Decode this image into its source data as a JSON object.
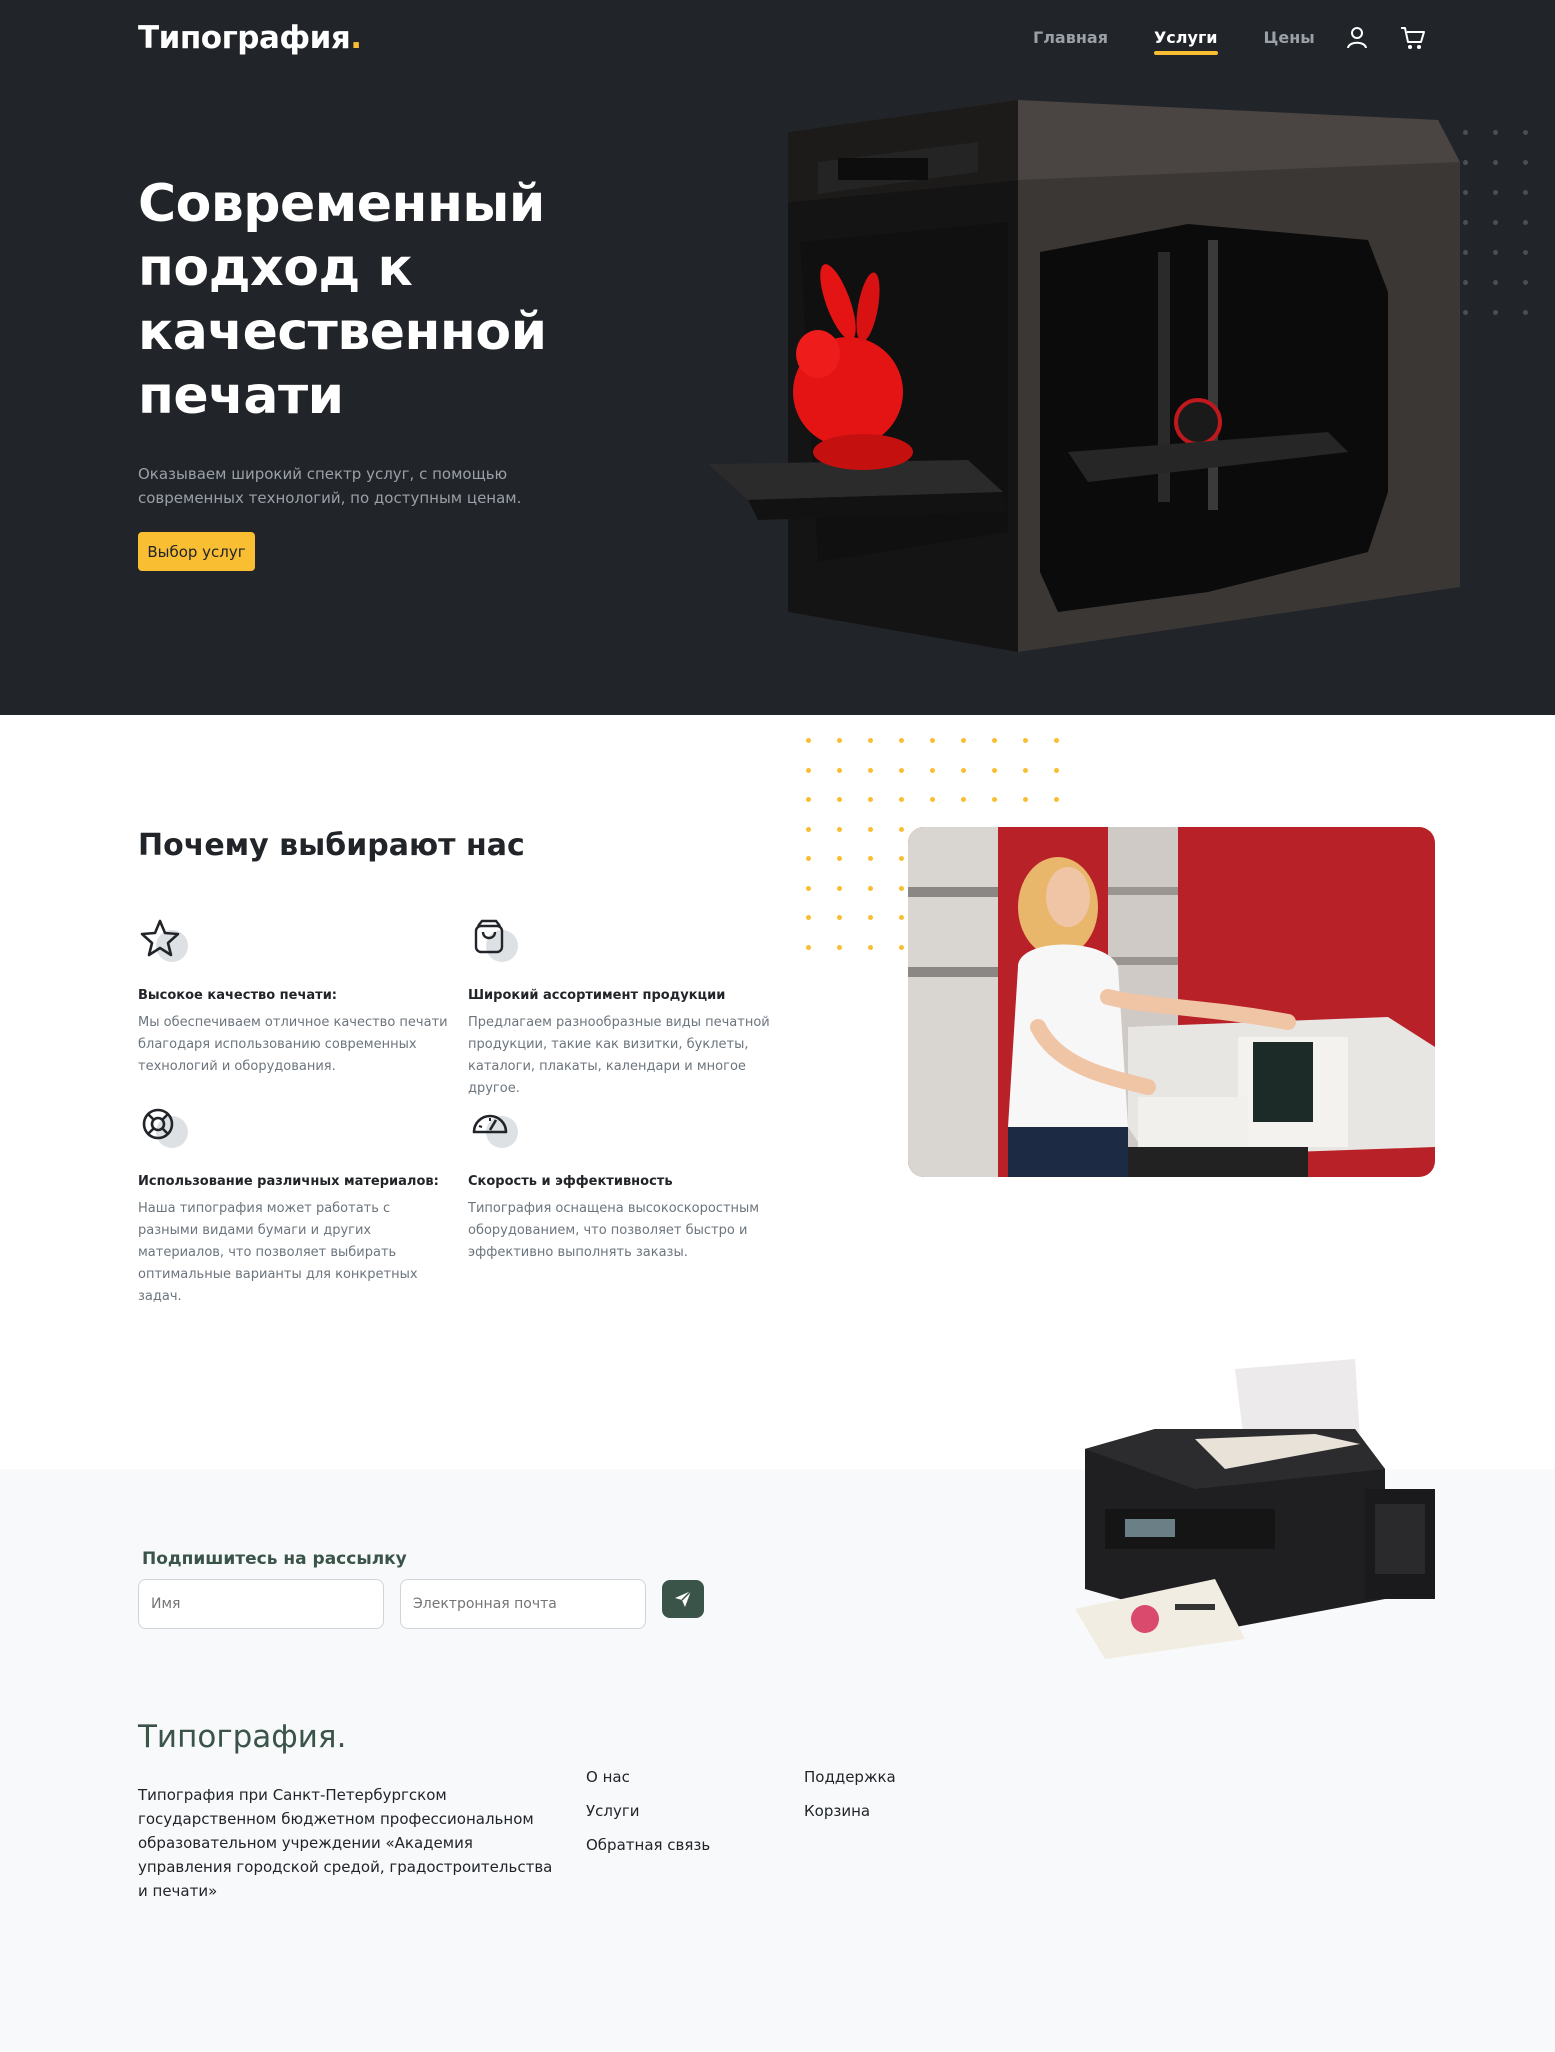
{
  "header": {
    "brand": "Типография",
    "brand_dot": ".",
    "nav": [
      {
        "label": "Главная"
      },
      {
        "label": "Услуги"
      },
      {
        "label": "Цены"
      }
    ],
    "icons": [
      "user-icon",
      "cart-icon"
    ]
  },
  "hero": {
    "title": "Современный подход к качественной печати",
    "text": "Оказываем широкий спектр услуг, с помощью современных технологий, по доступным ценам.",
    "button": "Выбор услуг"
  },
  "why": {
    "title": "Почему выбирают нас",
    "features": [
      {
        "icon": "star-icon",
        "title": "Высокое качество печати:",
        "text": "Мы обеспечиваем отличное качество печати благодаря использованию современных технологий и оборудования."
      },
      {
        "icon": "bag-icon",
        "title": "Широкий ассортимент продукции",
        "text": "Предлагаем разнообразные виды печатной продукции, такие как визитки, буклеты, каталоги, плакаты, календари и многое другое."
      },
      {
        "icon": "lifebuoy-icon",
        "title": "Использование различных материалов:",
        "text": "Наша типография может работать с разными видами бумаги и других материалов, что позволяет выбирать оптимальные варианты для конкретных задач."
      },
      {
        "icon": "speedometer-icon",
        "title": "Скорость и эффективность",
        "text": "Типография оснащена высокоскоростным оборудованием, что позволяет быстро и эффективно выполнять заказы."
      }
    ]
  },
  "subscribe": {
    "title": "Подпишитесь на рассылку",
    "name_placeholder": "Имя",
    "email_placeholder": "Электронная почта",
    "send_icon": "send-icon"
  },
  "footer": {
    "brand": "Типография.",
    "text": "Типография при Санкт-Петербургском государственном бюджетном профессиональном образовательном учреждении «Академия управления городской средой, градостроительства и печати»",
    "links_col1": [
      "О нас",
      "Услуги",
      "Обратная связь"
    ],
    "links_col2": [
      "Поддержка",
      "Корзина"
    ]
  },
  "colors": {
    "accent": "#f9be32",
    "dark": "#212429",
    "green": "#3b5449"
  }
}
